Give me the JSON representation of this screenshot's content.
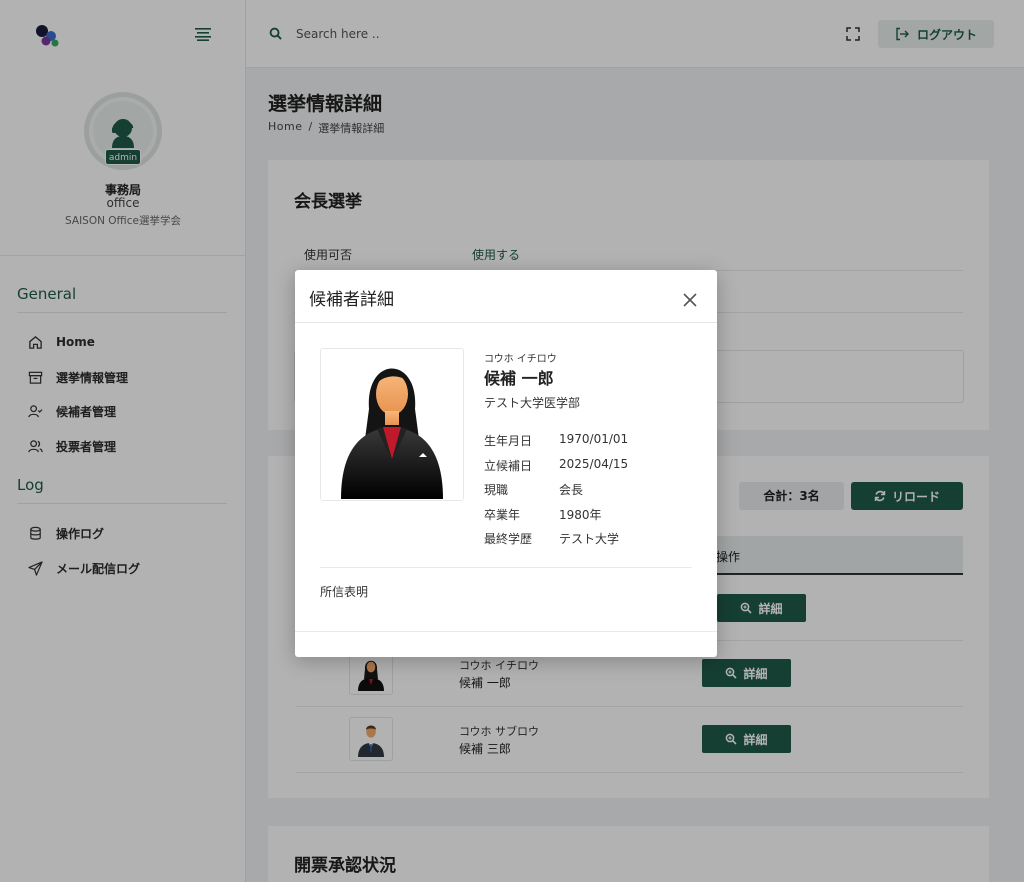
{
  "sidebar": {
    "user": {
      "name": "事務局",
      "role": "office",
      "org": "SAISON Office選挙学会",
      "badge": "admin"
    },
    "sections": [
      {
        "title": "General",
        "items": [
          {
            "label": "Home",
            "icon": "home-icon"
          },
          {
            "label": "選挙情報管理",
            "icon": "archive-icon"
          },
          {
            "label": "候補者管理",
            "icon": "user-check-icon"
          },
          {
            "label": "投票者管理",
            "icon": "users-icon"
          }
        ]
      },
      {
        "title": "Log",
        "items": [
          {
            "label": "操作ログ",
            "icon": "database-icon"
          },
          {
            "label": "メール配信ログ",
            "icon": "send-icon"
          }
        ]
      }
    ]
  },
  "topbar": {
    "search_placeholder": "Search here ..",
    "logout_label": "ログアウト"
  },
  "page": {
    "title": "選挙情報詳細",
    "breadcrumb": [
      "Home",
      "/",
      "選挙情報詳細"
    ]
  },
  "election": {
    "title": "会長選挙",
    "usage_label": "使用可否",
    "usage_value": "使用する"
  },
  "candidates": {
    "total": "合計：3名",
    "reload_label": "リロード",
    "header_action": "操作",
    "detail_label": "詳細",
    "rows": [
      {
        "kana": "コウホ イチロウ",
        "name": "候補 一郎"
      },
      {
        "kana": "コウホ サブロウ",
        "name": "候補 三郎"
      }
    ]
  },
  "approval": {
    "title": "開票承認状況"
  },
  "modal": {
    "title": "候補者詳細",
    "kana": "コウホ イチロウ",
    "name": "候補 一郎",
    "dept": "テスト大学医学部",
    "info": [
      {
        "label": "生年月日",
        "value": "1970/01/01"
      },
      {
        "label": "立候補日",
        "value": "2025/04/15"
      },
      {
        "label": "現職",
        "value": "会長"
      },
      {
        "label": "卒業年",
        "value": "1980年"
      },
      {
        "label": "最終学歴",
        "value": "テスト大学"
      }
    ],
    "statement_label": "所信表明"
  },
  "colors": {
    "accent": "#1f5b4a",
    "overlay": "rgba(0,0,0,0.30)"
  }
}
